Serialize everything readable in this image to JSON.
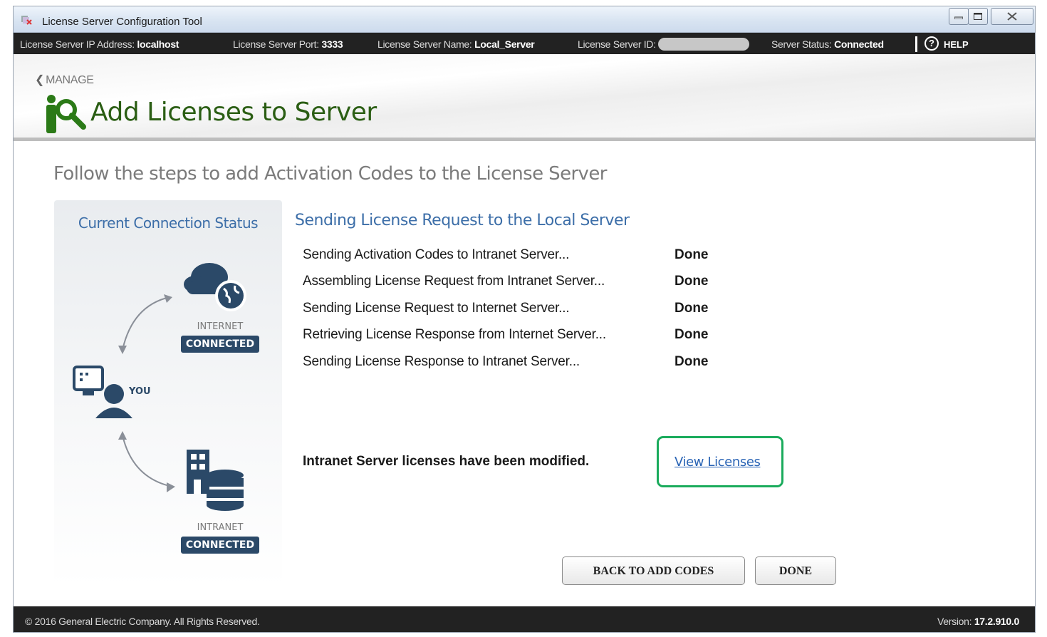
{
  "window": {
    "title": "License Server Configuration Tool"
  },
  "infobar": {
    "ip_label": "License Server IP Address:",
    "ip_value": "localhost",
    "port_label": "License Server Port:",
    "port_value": "3333",
    "name_label": "License Server Name:",
    "name_value": "Local_Server",
    "id_label": "License Server ID:",
    "status_label": "Server Status:",
    "status_value": "Connected",
    "help_label": "HELP"
  },
  "header": {
    "breadcrumb": "MANAGE",
    "title": "Add Licenses to Server"
  },
  "main": {
    "subtitle": "Follow the steps to add Activation Codes to the License Server",
    "status_panel": {
      "title": "Current Connection Status",
      "internet_label": "INTERNET",
      "internet_status": "CONNECTED",
      "you_label": "YOU",
      "intranet_label": "INTRANET",
      "intranet_status": "CONNECTED"
    },
    "progress_title": "Sending License Request to the Local Server",
    "steps": [
      {
        "label": "Sending Activation Codes to Intranet Server...",
        "status": "Done"
      },
      {
        "label": "Assembling License Request from Intranet Server...",
        "status": "Done"
      },
      {
        "label": "Sending License Request to Internet Server...",
        "status": "Done"
      },
      {
        "label": "Retrieving License Response from Internet Server...",
        "status": "Done"
      },
      {
        "label": "Sending License Response to Intranet Server...",
        "status": "Done"
      }
    ],
    "modified_message": "Intranet Server licenses have been modified.",
    "view_licenses_link": "View Licenses",
    "back_button": "BACK TO ADD CODES",
    "done_button": "DONE"
  },
  "footer": {
    "copyright": "© 2016 General Electric Company.  All Rights Reserved.",
    "version_label": "Version:",
    "version_value": "17.2.910.0"
  },
  "colors": {
    "accent_blue": "#3c6ea8",
    "title_green": "#2b5e14",
    "highlight_green": "#1aab5c",
    "badge_navy": "#2b4968",
    "bar_dark": "#222222"
  }
}
